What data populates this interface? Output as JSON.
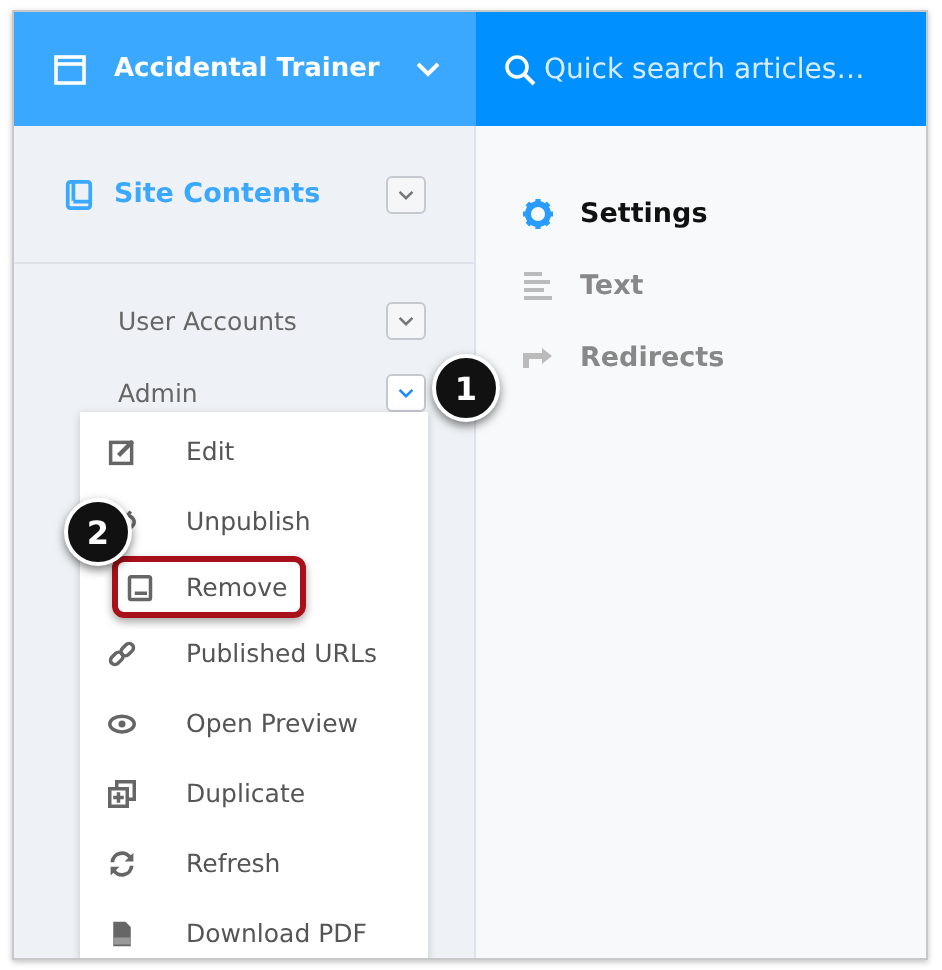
{
  "header": {
    "site_title": "Accidental Trainer",
    "search": {
      "placeholder": "Quick search articles…"
    }
  },
  "sidebar": {
    "heading": "Site Contents",
    "items": [
      {
        "label": "User Accounts",
        "expanded": false
      },
      {
        "label": "Admin",
        "expanded": true
      }
    ]
  },
  "action_menu": {
    "items": [
      {
        "label": "Edit",
        "highlighted": false
      },
      {
        "label": "Unpublish",
        "highlighted": false
      },
      {
        "label": "Remove",
        "highlighted": true
      },
      {
        "label": "Published URLs",
        "highlighted": false
      },
      {
        "label": "Open Preview",
        "highlighted": false
      },
      {
        "label": "Duplicate",
        "highlighted": false
      },
      {
        "label": "Refresh",
        "highlighted": false
      },
      {
        "label": "Download PDF",
        "highlighted": false
      }
    ]
  },
  "pages": [
    {
      "label": "Settings",
      "selected": true
    },
    {
      "label": "Text",
      "selected": false
    },
    {
      "label": "Redirects",
      "selected": false
    }
  ],
  "callouts": [
    {
      "number": "1"
    },
    {
      "number": "2"
    }
  ]
}
